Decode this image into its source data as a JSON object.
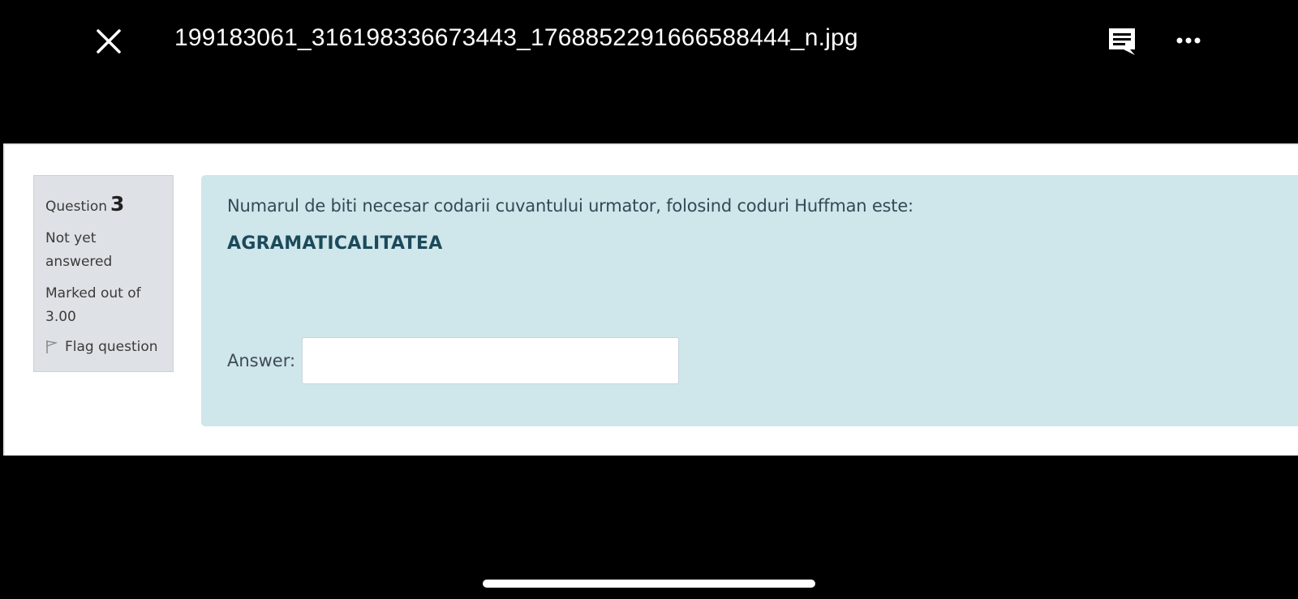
{
  "viewer": {
    "filename": "199183061_316198336673443_1768852291666588444_n.jpg",
    "close_icon": "close-icon",
    "comment_icon": "comment-icon",
    "more_icon": "more-options-icon"
  },
  "question": {
    "label": "Question",
    "number": "3",
    "state": "Not yet answered",
    "grade": "Marked out of 3.00",
    "flag_label": "Flag question",
    "text": "Numarul de biti necesar codarii cuvantului urmator, folosind coduri Huffman este:",
    "word": "AGRAMATICALITATEA",
    "answer_label": "Answer:",
    "answer_value": ""
  },
  "colors": {
    "content_bg": "#cfe6eb",
    "info_bg": "#dee2e6",
    "viewer_bg": "#000000"
  }
}
